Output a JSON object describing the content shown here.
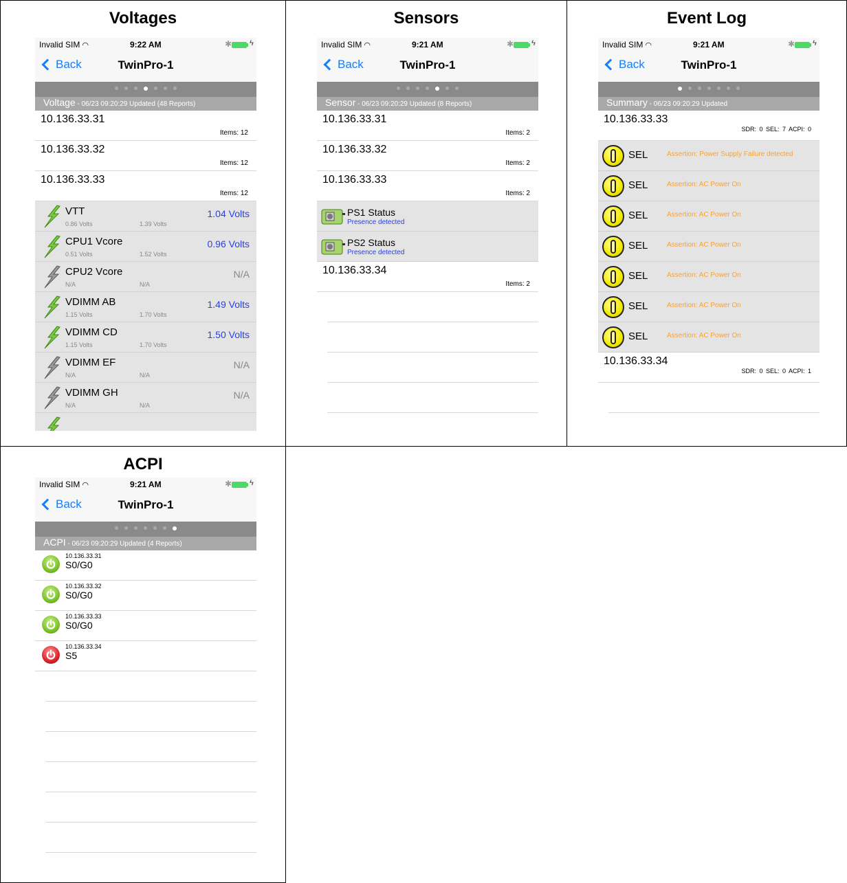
{
  "colors": {
    "link": "#147efb",
    "value": "#2a3fe0",
    "event": "#f3a33a",
    "header": "#a8a8a8",
    "pagebar": "#8a8a8a"
  },
  "status": {
    "carrier": "Invalid SIM",
    "wifi_icon": "wifi-icon",
    "bluetooth_icon": "bluetooth-icon",
    "battery_icon": "battery-icon"
  },
  "voltages": {
    "title": "Voltages",
    "time": "9:22 AM",
    "back": "Back",
    "nav_title": "TwinPro-1",
    "page_dots": 7,
    "active_dot": 3,
    "header_title": "Voltage",
    "header_sub": " - 06/23 09:20:29 Updated (48 Reports)",
    "hosts": [
      {
        "ip": "10.136.33.31",
        "items": "Items: 12"
      },
      {
        "ip": "10.136.33.32",
        "items": "Items: 12"
      },
      {
        "ip": "10.136.33.33",
        "items": "Items: 12"
      }
    ],
    "rows": [
      {
        "name": "VTT",
        "low": "0.86 Volts",
        "high": "1.39 Volts",
        "value": "1.04 Volts",
        "active": true
      },
      {
        "name": "CPU1 Vcore",
        "low": "0.51 Volts",
        "high": "1.52 Volts",
        "value": "0.96 Volts",
        "active": true
      },
      {
        "name": "CPU2 Vcore",
        "low": "N/A",
        "high": "N/A",
        "value": "N/A",
        "active": false
      },
      {
        "name": "VDIMM AB",
        "low": "1.15 Volts",
        "high": "1.70 Volts",
        "value": "1.49 Volts",
        "active": true
      },
      {
        "name": "VDIMM CD",
        "low": "1.15 Volts",
        "high": "1.70 Volts",
        "value": "1.50 Volts",
        "active": true
      },
      {
        "name": "VDIMM EF",
        "low": "N/A",
        "high": "N/A",
        "value": "N/A",
        "active": false
      },
      {
        "name": "VDIMM GH",
        "low": "N/A",
        "high": "N/A",
        "value": "N/A",
        "active": false
      }
    ]
  },
  "sensors": {
    "title": "Sensors",
    "time": "9:21 AM",
    "back": "Back",
    "nav_title": "TwinPro-1",
    "page_dots": 7,
    "active_dot": 4,
    "header_title": "Sensor",
    "header_sub": " - 06/23 09:20:29 Updated (8 Reports)",
    "hosts": [
      {
        "ip": "10.136.33.31",
        "items": "Items: 2"
      },
      {
        "ip": "10.136.33.32",
        "items": "Items: 2"
      },
      {
        "ip": "10.136.33.33",
        "items": "Items: 2"
      }
    ],
    "rows": [
      {
        "name": "PS1 Status",
        "state": "Presence detected"
      },
      {
        "name": "PS2 Status",
        "state": "Presence detected"
      }
    ],
    "last_host": {
      "ip": "10.136.33.34",
      "items": "Items: 2"
    }
  },
  "eventlog": {
    "title": "Event Log",
    "time": "9:21 AM",
    "back": "Back",
    "nav_title": "TwinPro-1",
    "page_dots": 7,
    "active_dot": 0,
    "header_title": "Summary",
    "header_sub": " - 06/23 09:20:29 Updated",
    "host": {
      "ip": "10.136.33.33",
      "counts": "SDR: 0    SEL: 7    ACPI: 0"
    },
    "rows": [
      {
        "type": "SEL",
        "msg": "Assertion: Power Supply Failure detected"
      },
      {
        "type": "SEL",
        "msg": "Assertion: AC Power On"
      },
      {
        "type": "SEL",
        "msg": "Assertion: AC Power On"
      },
      {
        "type": "SEL",
        "msg": "Assertion: AC Power On"
      },
      {
        "type": "SEL",
        "msg": "Assertion: AC Power On"
      },
      {
        "type": "SEL",
        "msg": "Assertion: AC Power On"
      },
      {
        "type": "SEL",
        "msg": "Assertion: AC Power On"
      }
    ],
    "last_host": {
      "ip": "10.136.33.34",
      "counts": "SDR: 0    SEL: 0    ACPI: 1"
    }
  },
  "acpi": {
    "title": "ACPI",
    "time": "9:21 AM",
    "back": "Back",
    "nav_title": "TwinPro-1",
    "page_dots": 7,
    "active_dot": 6,
    "header_title": "ACPI",
    "header_sub": " - 06/23 09:20:29 Updated (4 Reports)",
    "rows": [
      {
        "ip": "10.136.33.31",
        "state": "S0/G0",
        "on": true
      },
      {
        "ip": "10.136.33.32",
        "state": "S0/G0",
        "on": true
      },
      {
        "ip": "10.136.33.33",
        "state": "S0/G0",
        "on": true
      },
      {
        "ip": "10.136.33.34",
        "state": "S5",
        "on": false
      }
    ]
  }
}
